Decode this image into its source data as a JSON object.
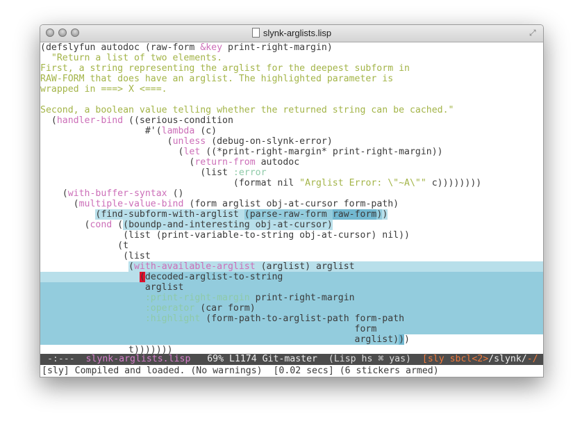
{
  "window": {
    "title": "slynk-arglists.lisp"
  },
  "colors": {
    "keyword": "#cc6eb8",
    "string": "#a3b448",
    "symbol": "#8ecaa8",
    "highlight_light": "#b8dfea",
    "highlight": "#93ccdd",
    "highlight_dark": "#72b8d0",
    "cursor": "#e0102c",
    "modeline_bg": "#4c4c4c",
    "accent_orange": "#f07a3c"
  },
  "editor": {
    "lines": [
      {
        "segs": [
          [
            "(defslyfun autodoc (raw-form ",
            "p"
          ],
          [
            "&key",
            "k"
          ],
          [
            " print-right-margin)",
            "p"
          ]
        ]
      },
      {
        "segs": [
          [
            "  \"Return a list of two elements.",
            "s"
          ]
        ]
      },
      {
        "segs": [
          [
            "First, a string representing the arglist for the deepest subform in",
            "s"
          ]
        ]
      },
      {
        "segs": [
          [
            "RAW-FORM that does have an arglist. The highlighted parameter is",
            "s"
          ]
        ]
      },
      {
        "segs": [
          [
            "wrapped in ===> X <===.",
            "s"
          ]
        ]
      },
      {
        "segs": [
          [
            "",
            "p"
          ]
        ]
      },
      {
        "segs": [
          [
            "Second, a boolean value telling whether the returned string can be cached.\"",
            "s"
          ]
        ]
      },
      {
        "segs": [
          [
            "  (",
            "p"
          ],
          [
            "handler-bind",
            "k"
          ],
          [
            " ((serious-condition",
            "p"
          ]
        ]
      },
      {
        "segs": [
          [
            "                   #'(",
            "p"
          ],
          [
            "lambda",
            "k"
          ],
          [
            " (c)",
            "p"
          ]
        ]
      },
      {
        "segs": [
          [
            "                       (",
            "p"
          ],
          [
            "unless",
            "k"
          ],
          [
            " (debug-on-slynk-error)",
            "p"
          ]
        ]
      },
      {
        "segs": [
          [
            "                         (",
            "p"
          ],
          [
            "let",
            "k"
          ],
          [
            " ((*print-right-margin* print-right-margin))",
            "p"
          ]
        ]
      },
      {
        "segs": [
          [
            "                           (",
            "p"
          ],
          [
            "return-from",
            "k"
          ],
          [
            " autodoc",
            "p"
          ]
        ]
      },
      {
        "segs": [
          [
            "                             (list ",
            "p"
          ],
          [
            ":error",
            "c"
          ]
        ]
      },
      {
        "segs": [
          [
            "                                   (format nil ",
            "p"
          ],
          [
            "\"Arglist Error: \\\"~A\\\"\"",
            "s"
          ],
          [
            " c))))))))",
            "p"
          ]
        ]
      },
      {
        "segs": [
          [
            "    (",
            "p"
          ],
          [
            "with-buffer-syntax",
            "k"
          ],
          [
            " ()",
            "p"
          ]
        ]
      },
      {
        "segs": [
          [
            "      (",
            "p"
          ],
          [
            "multiple-value-bind",
            "k"
          ],
          [
            " (form arglist obj-at-cursor form-path)",
            "p"
          ]
        ]
      },
      {
        "segs": [
          [
            "          ",
            "p"
          ],
          [
            "(find-subform-with-arglist ",
            "p bg1"
          ],
          [
            "(parse-raw-form ",
            "p bg2"
          ],
          [
            "raw-form",
            "p bg3"
          ],
          [
            ")",
            "p bg2"
          ],
          [
            ")",
            "p bg1"
          ]
        ]
      },
      {
        "segs": [
          [
            "        (",
            "p"
          ],
          [
            "cond",
            "k"
          ],
          [
            " (",
            "p"
          ],
          [
            "(boundp-and-interesting obj-at-cursor)",
            "p bg1"
          ]
        ]
      },
      {
        "segs": [
          [
            "               (list (print-variable-to-string obj-at-cursor) nil))",
            "p"
          ]
        ]
      },
      {
        "segs": [
          [
            "              (t",
            "p"
          ]
        ]
      },
      {
        "segs": [
          [
            "               (list",
            "p"
          ]
        ]
      },
      {
        "segs": [
          [
            "                ",
            "p"
          ],
          [
            "(",
            "p bg1"
          ],
          [
            "with-available-arglist",
            "k bg1"
          ],
          [
            " (arglist) arglist                                                        ",
            "p bg1"
          ]
        ]
      },
      {
        "full": "full-hl2",
        "segs": [
          [
            "                  ",
            "p bg1"
          ],
          [
            "(",
            "cur"
          ],
          [
            "decoded-arglist-to-string",
            "p"
          ]
        ]
      },
      {
        "full": "full-hl2",
        "segs": [
          [
            "                   arglist",
            "p"
          ]
        ]
      },
      {
        "full": "full-hl2",
        "segs": [
          [
            "                   ",
            "p"
          ],
          [
            ":print-right-margin",
            "c"
          ],
          [
            " print-right-margin",
            "p"
          ]
        ]
      },
      {
        "full": "full-hl2",
        "segs": [
          [
            "                   ",
            "p"
          ],
          [
            ":operator",
            "c"
          ],
          [
            " (car form)",
            "p"
          ]
        ]
      },
      {
        "full": "full-hl2",
        "segs": [
          [
            "                   ",
            "p"
          ],
          [
            ":highlight",
            "c"
          ],
          [
            " (form-path-to-arglist-path form-path",
            "p"
          ]
        ]
      },
      {
        "full": "full-hl2",
        "segs": [
          [
            "                                                         form",
            "p"
          ]
        ]
      },
      {
        "segs": [
          [
            "                                                         arglist)",
            "p bg2"
          ],
          [
            ")",
            "p bg3"
          ],
          [
            ")",
            "p"
          ]
        ]
      },
      {
        "segs": [
          [
            "                t)))))))",
            "p"
          ]
        ]
      }
    ]
  },
  "modeline": {
    "status": " -:---  ",
    "buffer": "slynk-arglists.lisp",
    "position": "   69% L1174 Git-master  ",
    "modes": "(Lisp hs ⌘ yas)",
    "sly_open": "  [",
    "sly": "sly",
    "impl": " sbcl<2>",
    "path": "/slynk/",
    "tail": "-/"
  },
  "echo": {
    "message": "[sly] Compiled and loaded. (No warnings)  [0.02 secs] (6 stickers armed)"
  }
}
